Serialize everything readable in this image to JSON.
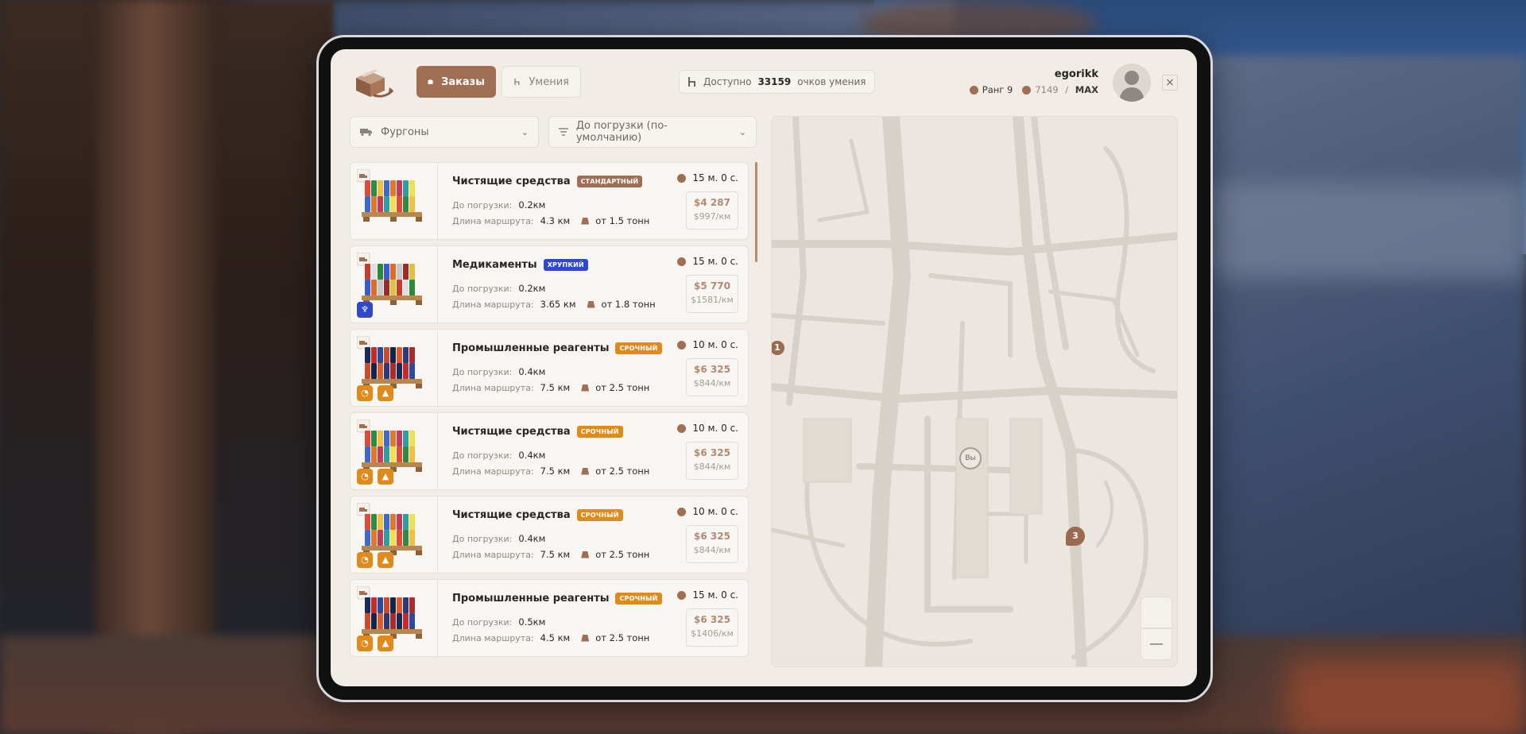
{
  "header": {
    "tabs": [
      {
        "label": "Заказы",
        "active": true,
        "icon": "box-icon"
      },
      {
        "label": "Умения",
        "active": false,
        "icon": "skill-tree-icon"
      }
    ],
    "skill_points": {
      "prefix": "Доступно",
      "value": "33159",
      "suffix": "очков умения"
    },
    "user": {
      "name": "egorikk",
      "rank": "Ранг 9",
      "xp_current": "7149",
      "xp_sep": " / ",
      "xp_max": "MAX"
    },
    "close": "×"
  },
  "filters": {
    "vehicle": "Фургоны",
    "sort": "До погрузки (по-умолчанию)"
  },
  "labels": {
    "to_load": "До погрузки:",
    "route_length": "Длина маршрута:"
  },
  "orders": [
    {
      "title": "Чистящие средства",
      "tag": "СТАНДАРТНЫЙ",
      "tag_type": "std",
      "to_load": "0.2км",
      "route": "4.3 км",
      "weight": "от 1.5 тонн",
      "time": "15 м. 0 с.",
      "price": "$4 287",
      "price_per_km": "$997/км",
      "cargo": "cleaning",
      "badges": []
    },
    {
      "title": "Медикаменты",
      "tag": "ХРУПКИЙ",
      "tag_type": "fragile",
      "to_load": "0.2км",
      "route": "3.65 км",
      "weight": "от 1.8 тонн",
      "time": "15 м. 0 с.",
      "price": "$5 770",
      "price_per_km": "$1581/км",
      "cargo": "medicine",
      "badges": [
        "fragile-glass-icon"
      ]
    },
    {
      "title": "Промышленные реагенты",
      "tag": "СРОЧНЫЙ",
      "tag_type": "urgent",
      "to_load": "0.4км",
      "route": "7.5 км",
      "weight": "от 2.5 тонн",
      "time": "10 м. 0 с.",
      "price": "$6 325",
      "price_per_km": "$844/км",
      "cargo": "reagents",
      "badges": [
        "clock-icon",
        "weight-icon"
      ]
    },
    {
      "title": "Чистящие средства",
      "tag": "СРОЧНЫЙ",
      "tag_type": "urgent",
      "to_load": "0.4км",
      "route": "7.5 км",
      "weight": "от 2.5 тонн",
      "time": "10 м. 0 с.",
      "price": "$6 325",
      "price_per_km": "$844/км",
      "cargo": "cleaning",
      "badges": [
        "clock-icon",
        "weight-icon"
      ]
    },
    {
      "title": "Чистящие средства",
      "tag": "СРОЧНЫЙ",
      "tag_type": "urgent",
      "to_load": "0.4км",
      "route": "7.5 км",
      "weight": "от 2.5 тонн",
      "time": "10 м. 0 с.",
      "price": "$6 325",
      "price_per_km": "$844/км",
      "cargo": "cleaning",
      "badges": [
        "clock-icon",
        "weight-icon"
      ]
    },
    {
      "title": "Промышленные реагенты",
      "tag": "СРОЧНЫЙ",
      "tag_type": "urgent",
      "to_load": "0.5км",
      "route": "4.5 км",
      "weight": "от 2.5 тонн",
      "time": "15 м. 0 с.",
      "price": "$6 325",
      "price_per_km": "$1406/км",
      "cargo": "reagents",
      "badges": [
        "clock-icon",
        "weight-icon"
      ]
    }
  ],
  "map": {
    "you_label": "Вы",
    "markers": [
      {
        "label": "1"
      },
      {
        "label": "3"
      }
    ],
    "zoom_in": "+",
    "zoom_out": "—"
  },
  "colors": {
    "accent": "#a06e52",
    "urgent": "#e08a1c",
    "fragile": "#2f49c8",
    "panel": "#f1ede6"
  }
}
